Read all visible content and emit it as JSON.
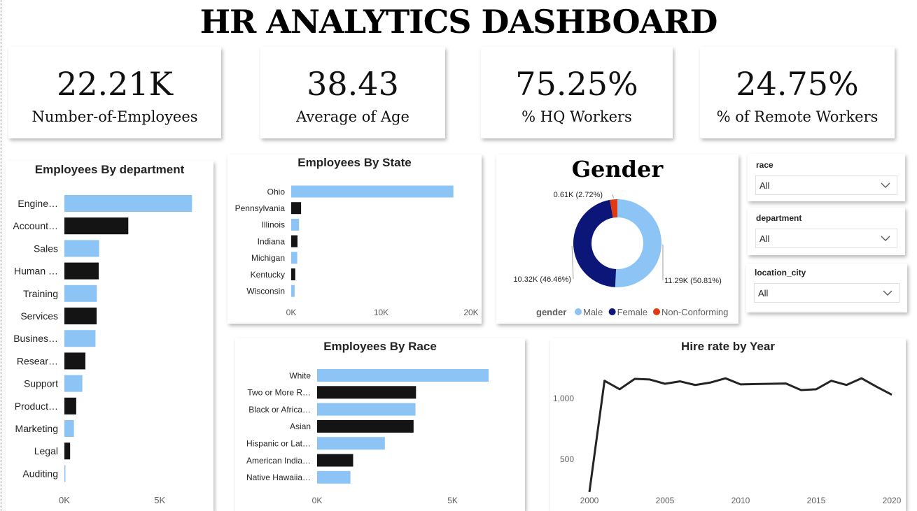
{
  "title": "HR ANALYTICS DASHBOARD",
  "kpis": [
    {
      "value": "22.21K",
      "label": "Number-of-Employees"
    },
    {
      "value": "38.43",
      "label": "Average of Age"
    },
    {
      "value": "75.25%",
      "label": "% HQ Workers"
    },
    {
      "value": "24.75%",
      "label": "% of Remote Workers"
    }
  ],
  "slicers": [
    {
      "label": "race",
      "value": "All"
    },
    {
      "label": "department",
      "value": "All"
    },
    {
      "label": "location_city",
      "value": "All"
    }
  ],
  "colors": {
    "light_blue": "#8cc4f6",
    "black": "#141414",
    "navy": "#0b1678",
    "red": "#e23a10",
    "line": "#252423"
  },
  "chart_data": [
    {
      "id": "department",
      "type": "bar",
      "orientation": "horizontal",
      "title": "Employees By department",
      "categories": [
        "Engine…",
        "Account…",
        "Sales",
        "Human …",
        "Training",
        "Services",
        "Busines…",
        "Resear…",
        "Support",
        "Product…",
        "Marketing",
        "Legal",
        "Auditing"
      ],
      "values": [
        6690,
        3350,
        1820,
        1800,
        1700,
        1690,
        1630,
        1100,
        940,
        620,
        500,
        300,
        55
      ],
      "colors": [
        "#8cc4f6",
        "#141414",
        "#8cc4f6",
        "#141414",
        "#8cc4f6",
        "#141414",
        "#8cc4f6",
        "#141414",
        "#8cc4f6",
        "#141414",
        "#8cc4f6",
        "#141414",
        "#8cc4f6"
      ],
      "xlim": [
        0,
        8000
      ],
      "xticks": [
        "0K",
        "5K"
      ],
      "xtick_values": [
        0,
        5000
      ]
    },
    {
      "id": "state",
      "type": "bar",
      "orientation": "horizontal",
      "title": "Employees By State",
      "categories": [
        "Ohio",
        "Pennsylvania",
        "Illinois",
        "Indiana",
        "Michigan",
        "Kentucky",
        "Wisconsin"
      ],
      "values": [
        18030,
        1100,
        870,
        700,
        670,
        450,
        380
      ],
      "colors": [
        "#8cc4f6",
        "#141414",
        "#8cc4f6",
        "#141414",
        "#8cc4f6",
        "#141414",
        "#8cc4f6"
      ],
      "xlim": [
        0,
        20000
      ],
      "xticks": [
        "0K",
        "10K",
        "20K"
      ],
      "xtick_values": [
        0,
        10000,
        20000
      ]
    },
    {
      "id": "race",
      "type": "bar",
      "orientation": "horizontal",
      "title": "Employees By Race",
      "categories": [
        "White",
        "Two or More R…",
        "Black or Africa…",
        "Asian",
        "Hispanic or Lat…",
        "American India…",
        "Native Hawaiia…"
      ],
      "values": [
        6330,
        3650,
        3630,
        3560,
        2500,
        1330,
        1230
      ],
      "colors": [
        "#8cc4f6",
        "#141414",
        "#8cc4f6",
        "#141414",
        "#8cc4f6",
        "#141414",
        "#8cc4f6"
      ],
      "xlim": [
        0,
        7000
      ],
      "xticks": [
        "0K",
        "5K"
      ],
      "xtick_values": [
        0,
        5000
      ]
    },
    {
      "id": "gender",
      "type": "pie",
      "title": "Gender",
      "legend_title": "gender",
      "slices": [
        {
          "name": "Male",
          "value": 11288,
          "label": "11.29K (50.81%)",
          "color": "#8cc4f6"
        },
        {
          "name": "Female",
          "value": 10321,
          "label": "10.32K (46.46%)",
          "color": "#0b1678"
        },
        {
          "name": "Non-Conforming",
          "value": 605,
          "label": "0.61K (2.72%)",
          "color": "#e23a10"
        }
      ]
    },
    {
      "id": "hire",
      "type": "line",
      "title": "Hire rate by Year",
      "x": [
        2000,
        2001,
        2002,
        2003,
        2004,
        2005,
        2006,
        2007,
        2008,
        2009,
        2010,
        2011,
        2012,
        2013,
        2014,
        2015,
        2016,
        2017,
        2018,
        2019,
        2020
      ],
      "values": [
        230,
        1145,
        1075,
        1160,
        1155,
        1120,
        1140,
        1110,
        1130,
        1165,
        1115,
        1118,
        1120,
        1122,
        1068,
        1075,
        1145,
        1110,
        1165,
        1095,
        1030
      ],
      "xlim": [
        2000,
        2020
      ],
      "ylim": [
        200,
        1350
      ],
      "xticks": [
        "2000",
        "2005",
        "2010",
        "2015",
        "2020"
      ],
      "xtick_values": [
        2000,
        2005,
        2010,
        2015,
        2020
      ],
      "yticks": [
        "1,000",
        "500"
      ],
      "ytick_values": [
        1000,
        500
      ]
    }
  ]
}
